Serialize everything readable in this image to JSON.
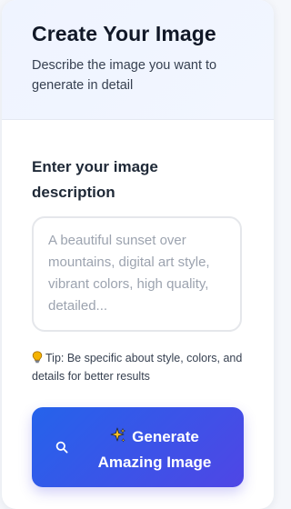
{
  "header": {
    "title": "Create Your Image",
    "subtitle": "Describe the image you want to generate in detail"
  },
  "form": {
    "label": "Enter your image description",
    "textarea_value": "",
    "textarea_placeholder": "A beautiful sunset over mountains, digital art style, vibrant colors, high quality, detailed...",
    "tip": "Tip: Be specific about style, colors, and details for better results",
    "tip_icon": "lightbulb-icon"
  },
  "button": {
    "label": "Generate Amazing Image",
    "icons": [
      "search-icon",
      "sparkle-icon"
    ]
  },
  "colors": {
    "accent_start": "#2563eb",
    "accent_end": "#4f46e5",
    "header_bg": "#eff4ff"
  }
}
